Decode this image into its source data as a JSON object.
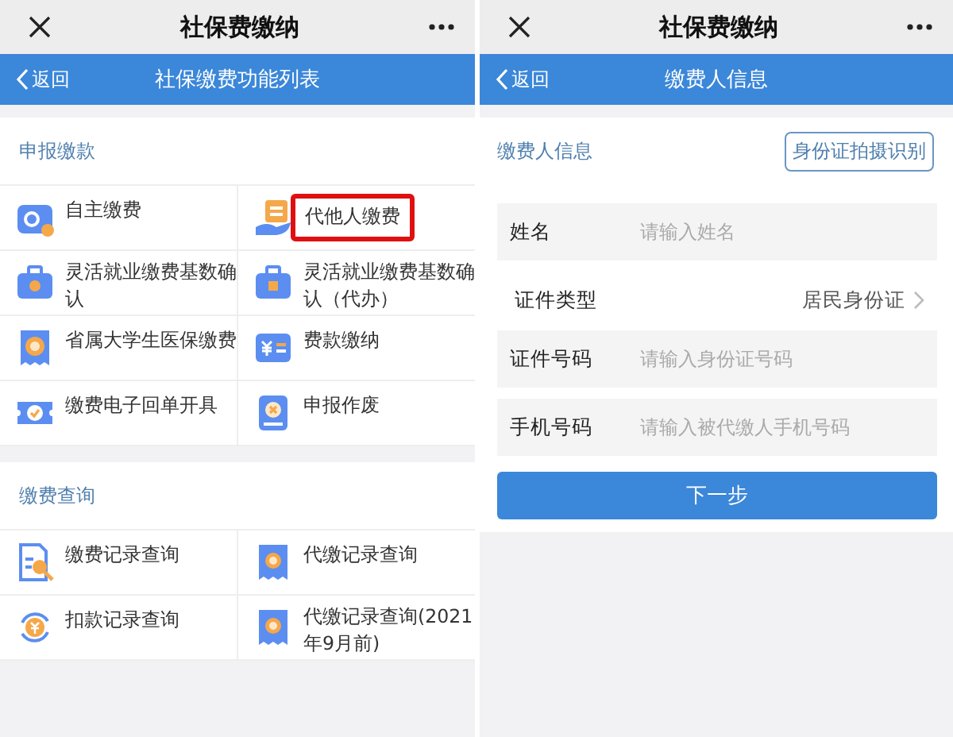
{
  "screens": [
    {
      "kind": "menu",
      "top_bar": {
        "title": "社保费缴纳"
      },
      "nav_bar": {
        "back": "返回",
        "title": "社保缴费功能列表"
      },
      "sections": [
        {
          "heading": "申报缴款",
          "items": [
            {
              "label": "自主缴费",
              "highlighted": false
            },
            {
              "label": "代他人缴费",
              "highlighted": true
            },
            {
              "label": "灵活就业缴费基数确认",
              "highlighted": false
            },
            {
              "label": "灵活就业缴费基数确认（代办）",
              "highlighted": false
            },
            {
              "label": "省属大学生医保缴费",
              "highlighted": false
            },
            {
              "label": "费款缴纳",
              "highlighted": false
            },
            {
              "label": "缴费电子回单开具",
              "highlighted": false
            },
            {
              "label": "申报作废",
              "highlighted": false
            }
          ]
        },
        {
          "heading": "缴费查询",
          "items": [
            {
              "label": "缴费记录查询",
              "highlighted": false
            },
            {
              "label": "代缴记录查询",
              "highlighted": false
            },
            {
              "label": "扣款记录查询",
              "highlighted": false
            },
            {
              "label": "代缴记录查询(2021年9月前)",
              "highlighted": false
            }
          ]
        }
      ]
    },
    {
      "kind": "form",
      "top_bar": {
        "title": "社保费缴纳"
      },
      "nav_bar": {
        "back": "返回",
        "title": "缴费人信息"
      },
      "form": {
        "heading": "缴费人信息",
        "scan_button": "身份证拍摄识别",
        "fields": [
          {
            "kind": "input",
            "label": "姓名",
            "placeholder": "请输入姓名"
          },
          {
            "kind": "select",
            "label": "证件类型",
            "value": "居民身份证"
          },
          {
            "kind": "input",
            "label": "证件号码",
            "placeholder": "请输入身份证号码"
          },
          {
            "kind": "input",
            "label": "手机号码",
            "placeholder": "请输入被代缴人手机号码"
          }
        ],
        "submit": "下一步"
      }
    }
  ]
}
